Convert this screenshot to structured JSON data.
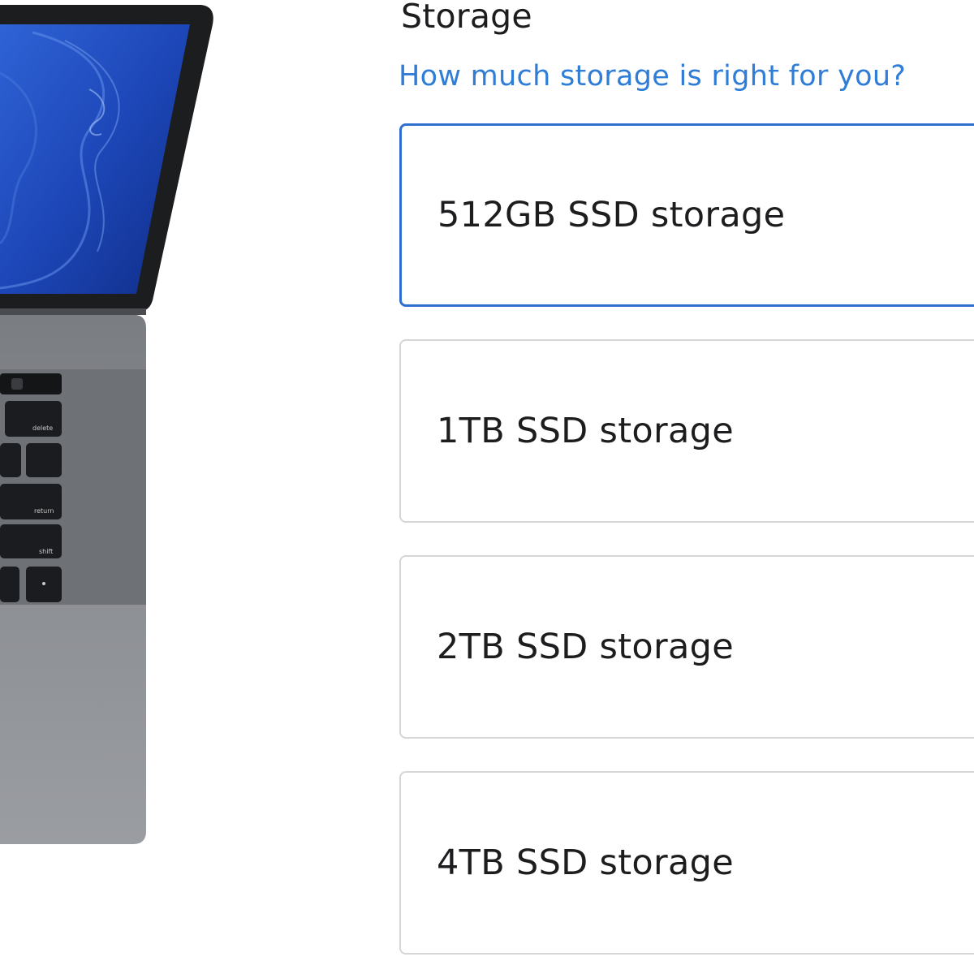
{
  "storage": {
    "title": "Storage",
    "help_link": "How much storage is right for you?",
    "accent_color": "#2f6fd0",
    "selected_index": 0,
    "options": [
      {
        "label": "512GB SSD storage",
        "selected": true
      },
      {
        "label": "1TB SSD storage",
        "selected": false
      },
      {
        "label": "2TB SSD storage",
        "selected": false
      },
      {
        "label": "4TB SSD storage",
        "selected": false
      }
    ]
  },
  "product_image": {
    "icon": "laptop-image",
    "keys": {
      "delete": "delete",
      "return": "return",
      "shift": "shift"
    }
  }
}
